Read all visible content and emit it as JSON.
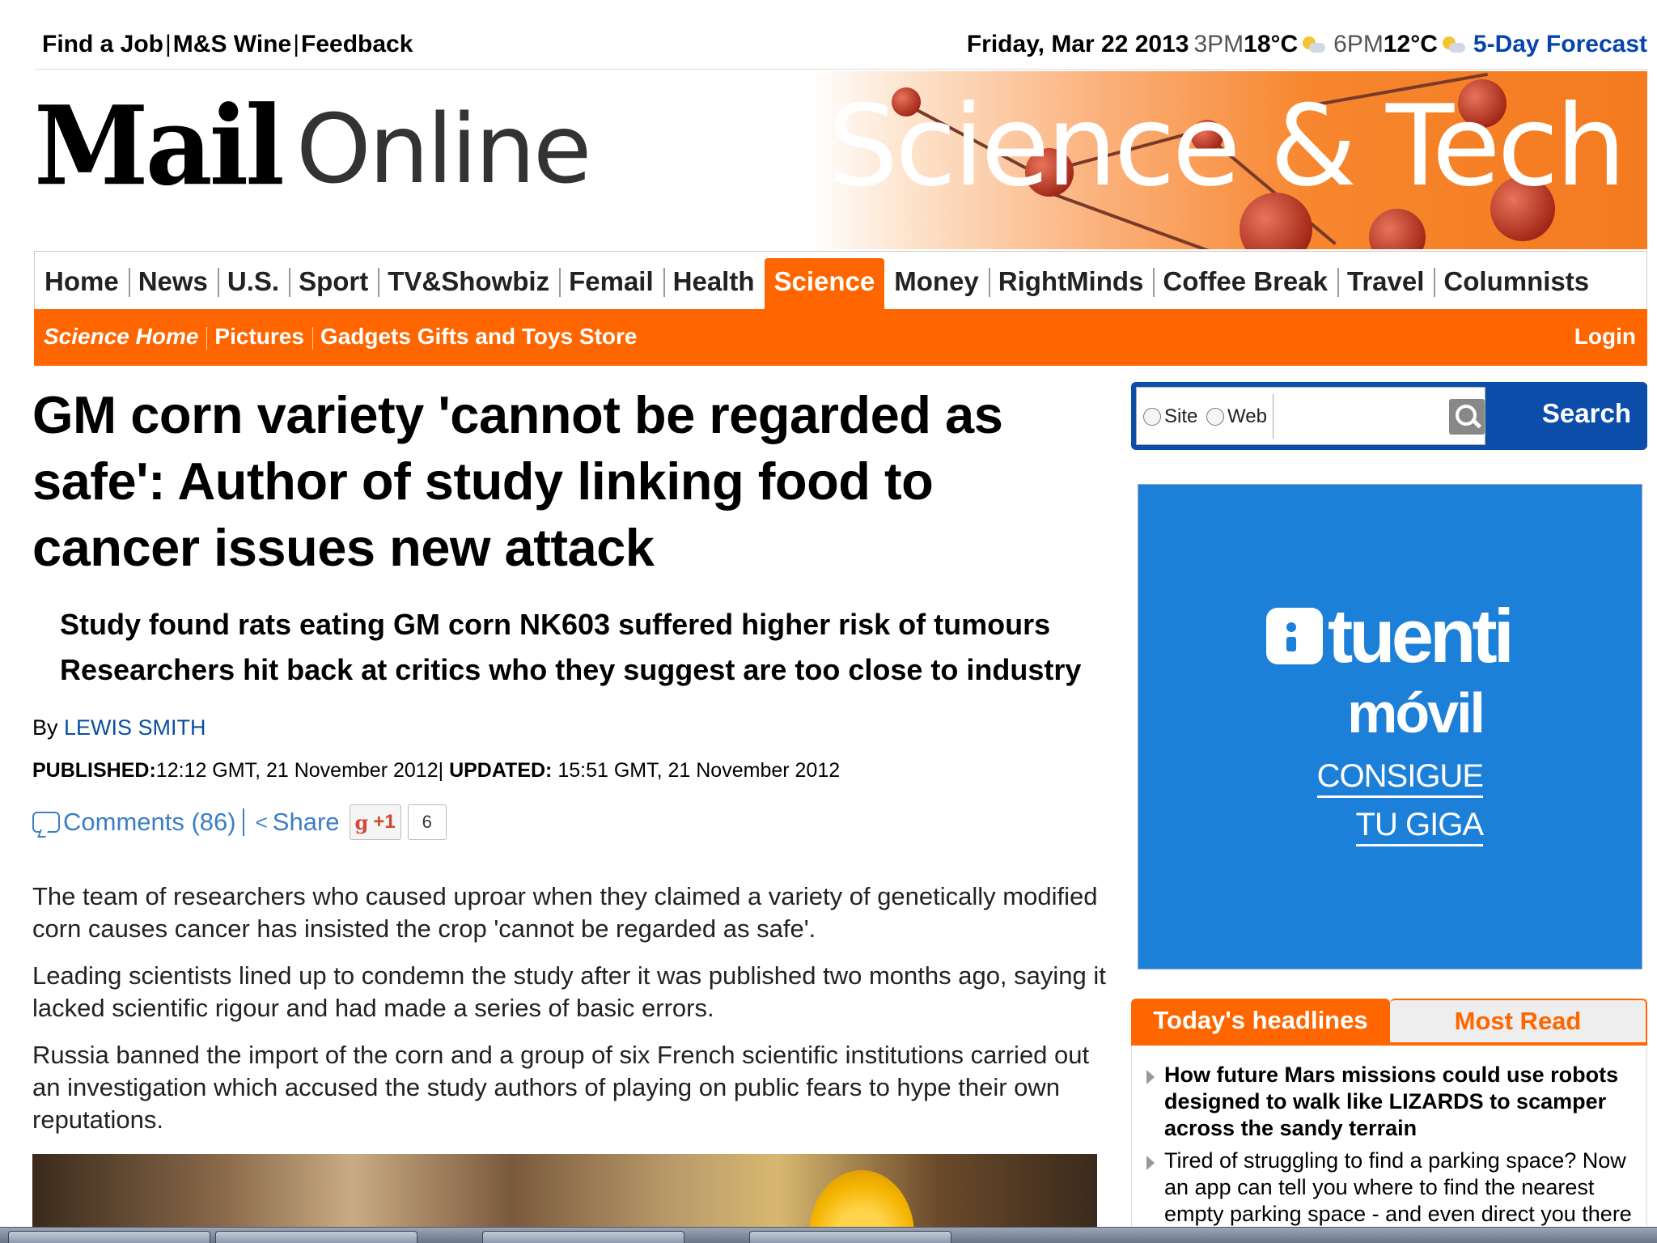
{
  "topbar": {
    "links": [
      "Find a Job",
      "M&S Wine",
      "Feedback"
    ],
    "date": "Friday, Mar 22 2013",
    "weather": [
      {
        "time": "3PM",
        "temp": "18°C",
        "icon": "partly-cloudy-icon"
      },
      {
        "time": "6PM",
        "temp": "12°C",
        "icon": "partly-cloudy-icon"
      }
    ],
    "forecast_link": "5-Day Forecast"
  },
  "header": {
    "logo_mail": "Mail",
    "logo_online": "Online",
    "section_banner": "Science & Tech"
  },
  "nav": {
    "items": [
      "Home",
      "News",
      "U.S.",
      "Sport",
      "TV&Showbiz",
      "Femail",
      "Health",
      "Science",
      "Money",
      "RightMinds",
      "Coffee Break",
      "Travel",
      "Columnists"
    ],
    "active": "Science"
  },
  "subnav": {
    "items": [
      "Science Home",
      "Pictures",
      "Gadgets Gifts and Toys Store"
    ],
    "login": "Login"
  },
  "article": {
    "headline": "GM corn variety 'cannot be regarded as safe': Author of study linking food to cancer issues new attack",
    "bullets": [
      "Study found rats eating GM corn NK603 suffered higher risk of tumours",
      "Researchers hit back at critics who they suggest are too close to industry"
    ],
    "byline_prefix": "By",
    "author": "LEWIS SMITH",
    "published_label": "PUBLISHED:",
    "published_value": "12:12 GMT, 21 November 2012",
    "updated_label": "UPDATED:",
    "updated_value": "15:51 GMT, 21 November 2012",
    "comments": "Comments (86)",
    "share": "Share",
    "gplus_label": "+1",
    "gplus_count": "6",
    "paragraphs": [
      "The team of researchers who caused uproar when they claimed a variety of genetically modified corn causes cancer has insisted the crop 'cannot be regarded as safe'.",
      "Leading scientists lined up to condemn the study after it was published two months ago, saying it lacked scientific rigour and had made a series of basic errors.",
      "Russia banned the import of the corn and a group of six French scientific institutions carried out an investigation which accused the study authors of playing on public fears to hype their own reputations."
    ]
  },
  "search": {
    "option_site": "Site",
    "option_web": "Web",
    "placeholder": "",
    "button": "Search"
  },
  "ad": {
    "brand": "tuenti",
    "sub": "móvil",
    "cta_line1": "CONSIGUE",
    "cta_line2": "TU GIGA",
    "bg_color": "#1c7fd8"
  },
  "widget": {
    "tab_today": "Today's headlines",
    "tab_most": "Most Read",
    "headlines": [
      "How future Mars missions could use robots designed to walk like LIZARDS to scamper across the sandy terrain",
      "Tired of struggling to find a parking space? Now an app can tell you where to find the nearest empty parking space - and even direct you there"
    ]
  },
  "colors": {
    "brand_orange": "#ff6600",
    "link_blue": "#0645ad",
    "search_blue": "#0b4da8"
  }
}
